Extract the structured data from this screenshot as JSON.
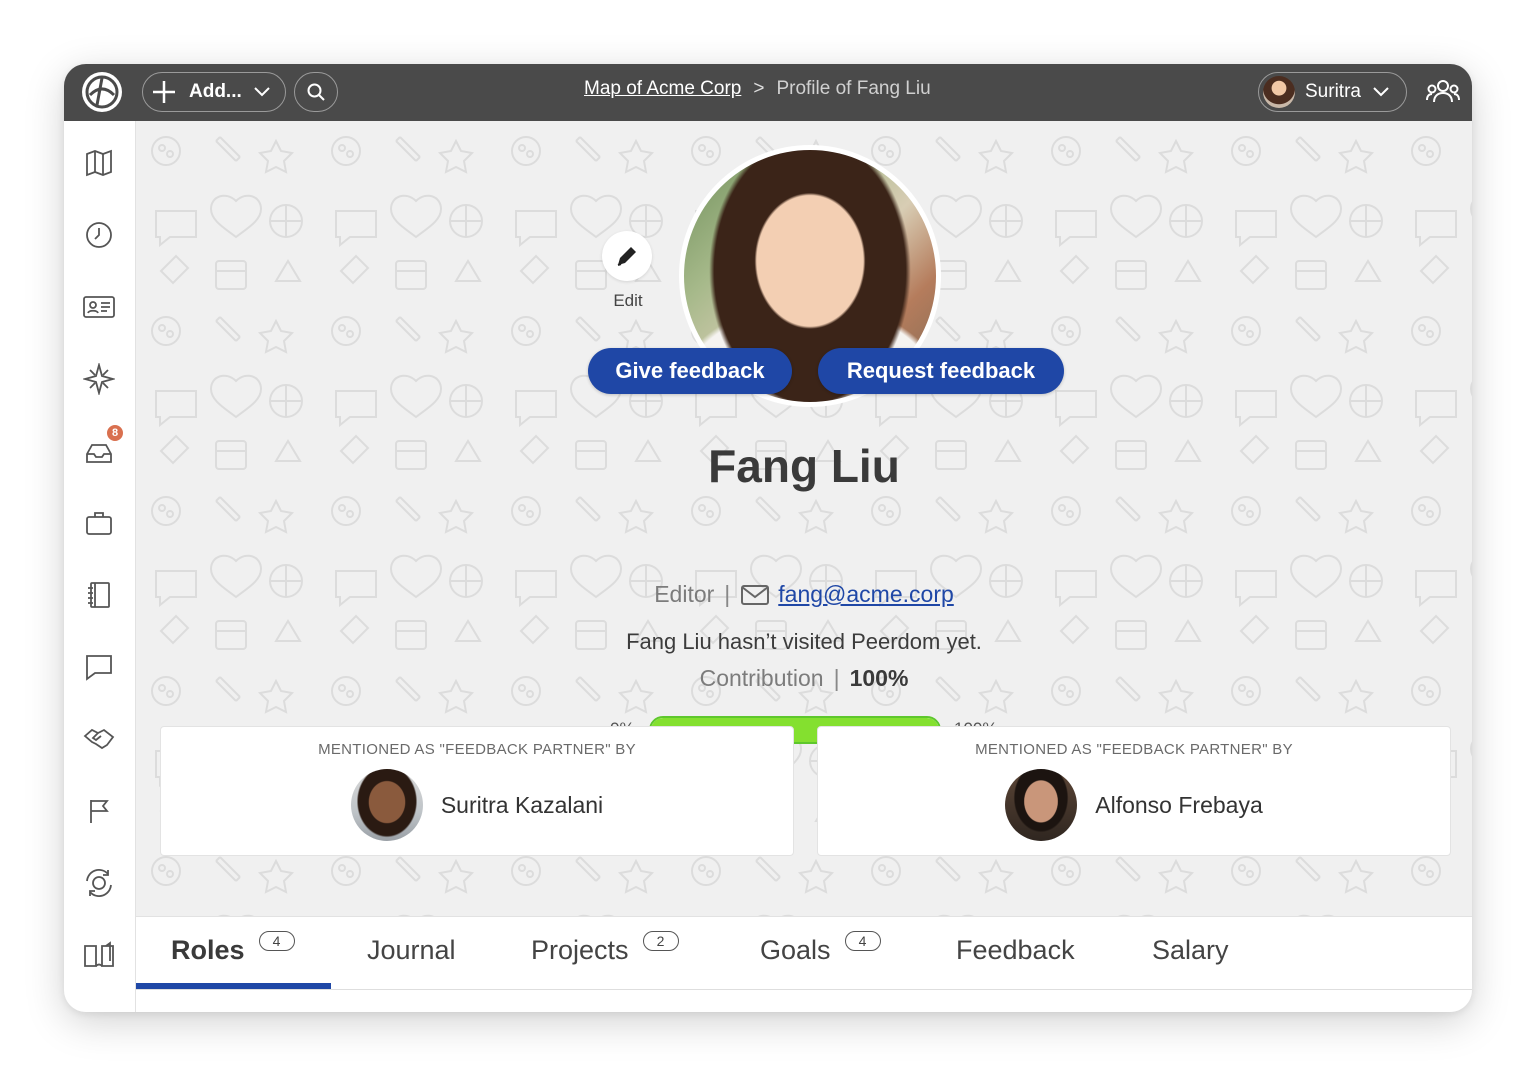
{
  "topbar": {
    "add_label": "Add...",
    "breadcrumb_link": "Map of Acme Corp",
    "breadcrumb_sep": ">",
    "breadcrumb_current": "Profile of Fang Liu",
    "user_name": "Suritra"
  },
  "sidebar": {
    "items": [
      {
        "icon": "map-icon"
      },
      {
        "icon": "clock-icon"
      },
      {
        "icon": "id-card-icon"
      },
      {
        "icon": "compass-star-icon"
      },
      {
        "icon": "inbox-icon",
        "badge": "8"
      },
      {
        "icon": "briefcase-icon"
      },
      {
        "icon": "notebook-icon"
      },
      {
        "icon": "chat-icon"
      },
      {
        "icon": "handshake-icon"
      },
      {
        "icon": "flag-icon"
      },
      {
        "icon": "sync-icon"
      },
      {
        "icon": "book-icon"
      }
    ]
  },
  "profile": {
    "edit_label": "Edit",
    "give_feedback": "Give feedback",
    "request_feedback": "Request feedback",
    "name": "Fang Liu",
    "role": "Editor",
    "email": "fang@acme.corp",
    "visited": "Fang Liu hasn’t visited Peerdom yet.",
    "contribution_label": "Contribution",
    "contribution_value": "100%",
    "progress_min": "0%",
    "progress_max": "100%",
    "progress_fraction": 1.0
  },
  "partners": [
    {
      "heading": "MENTIONED AS \"FEEDBACK PARTNER\" BY",
      "name": "Suritra Kazalani"
    },
    {
      "heading": "MENTIONED AS \"FEEDBACK PARTNER\" BY",
      "name": "Alfonso Frebaya"
    }
  ],
  "tabs": [
    {
      "label": "Roles",
      "count": "4",
      "active": true
    },
    {
      "label": "Journal"
    },
    {
      "label": "Projects",
      "count": "2"
    },
    {
      "label": "Goals",
      "count": "4"
    },
    {
      "label": "Feedback"
    },
    {
      "label": "Salary"
    }
  ],
  "colors": {
    "accent": "#1f47a6",
    "progress": "#84e02f",
    "topbar": "#4a4a4a",
    "badge": "#d9704f"
  }
}
